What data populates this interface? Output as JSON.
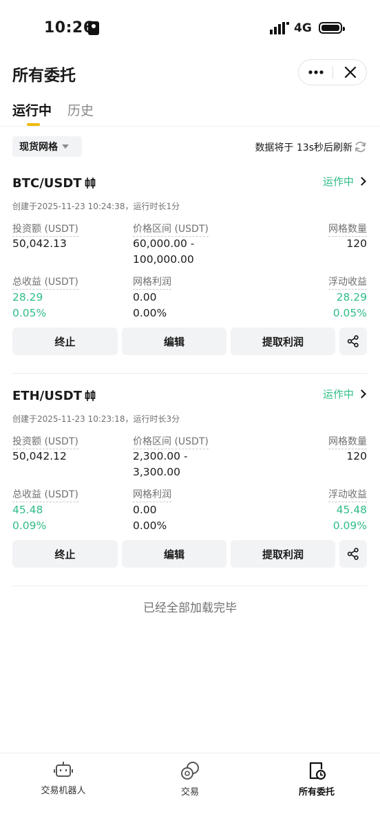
{
  "status_bar": {
    "time": "10:26",
    "network": "4G"
  },
  "header": {
    "title": "所有委托"
  },
  "tabs": [
    {
      "label": "运行中"
    },
    {
      "label": "历史"
    }
  ],
  "filter": {
    "label": "现货网格"
  },
  "refresh": {
    "text": "数据将于 13s秒后刷新"
  },
  "labels": {
    "investment": "投资额 (USDT)",
    "price_range": "价格区间 (USDT)",
    "grid_count": "网格数量",
    "total_profit": "总收益 (USDT)",
    "grid_profit": "网格利润",
    "floating_profit": "浮动收益"
  },
  "buttons": {
    "stop": "终止",
    "edit": "编辑",
    "withdraw": "提取利润"
  },
  "cards": [
    {
      "pair": "BTC/USDT",
      "status": "运作中",
      "created": "创建于2025-11-23 10:24:38，运行时长1分",
      "investment": "50,042.13",
      "price_range_line1": "60,000.00 -",
      "price_range_line2": "100,000.00",
      "grid_count": "120",
      "total_profit": "28.29",
      "total_profit_pct": "0.05%",
      "grid_profit": "0.00",
      "grid_profit_pct": "0.00%",
      "floating_profit": "28.29",
      "floating_profit_pct": "0.05%"
    },
    {
      "pair": "ETH/USDT",
      "status": "运作中",
      "created": "创建于2025-11-23 10:23:18，运行时长3分",
      "investment": "50,042.12",
      "price_range_line1": "2,300.00 -",
      "price_range_line2": "3,300.00",
      "grid_count": "120",
      "total_profit": "45.48",
      "total_profit_pct": "0.09%",
      "grid_profit": "0.00",
      "grid_profit_pct": "0.00%",
      "floating_profit": "45.48",
      "floating_profit_pct": "0.09%"
    }
  ],
  "footer_message": "已经全部加载完毕",
  "bottom_nav": [
    {
      "label": "交易机器人",
      "icon": "robot-icon"
    },
    {
      "label": "交易",
      "icon": "trade-icon"
    },
    {
      "label": "所有委托",
      "icon": "orders-icon"
    }
  ],
  "colors": {
    "accent": "#f0b90b",
    "positive": "#2ebd85",
    "chip_bg": "#f2f3f5"
  }
}
